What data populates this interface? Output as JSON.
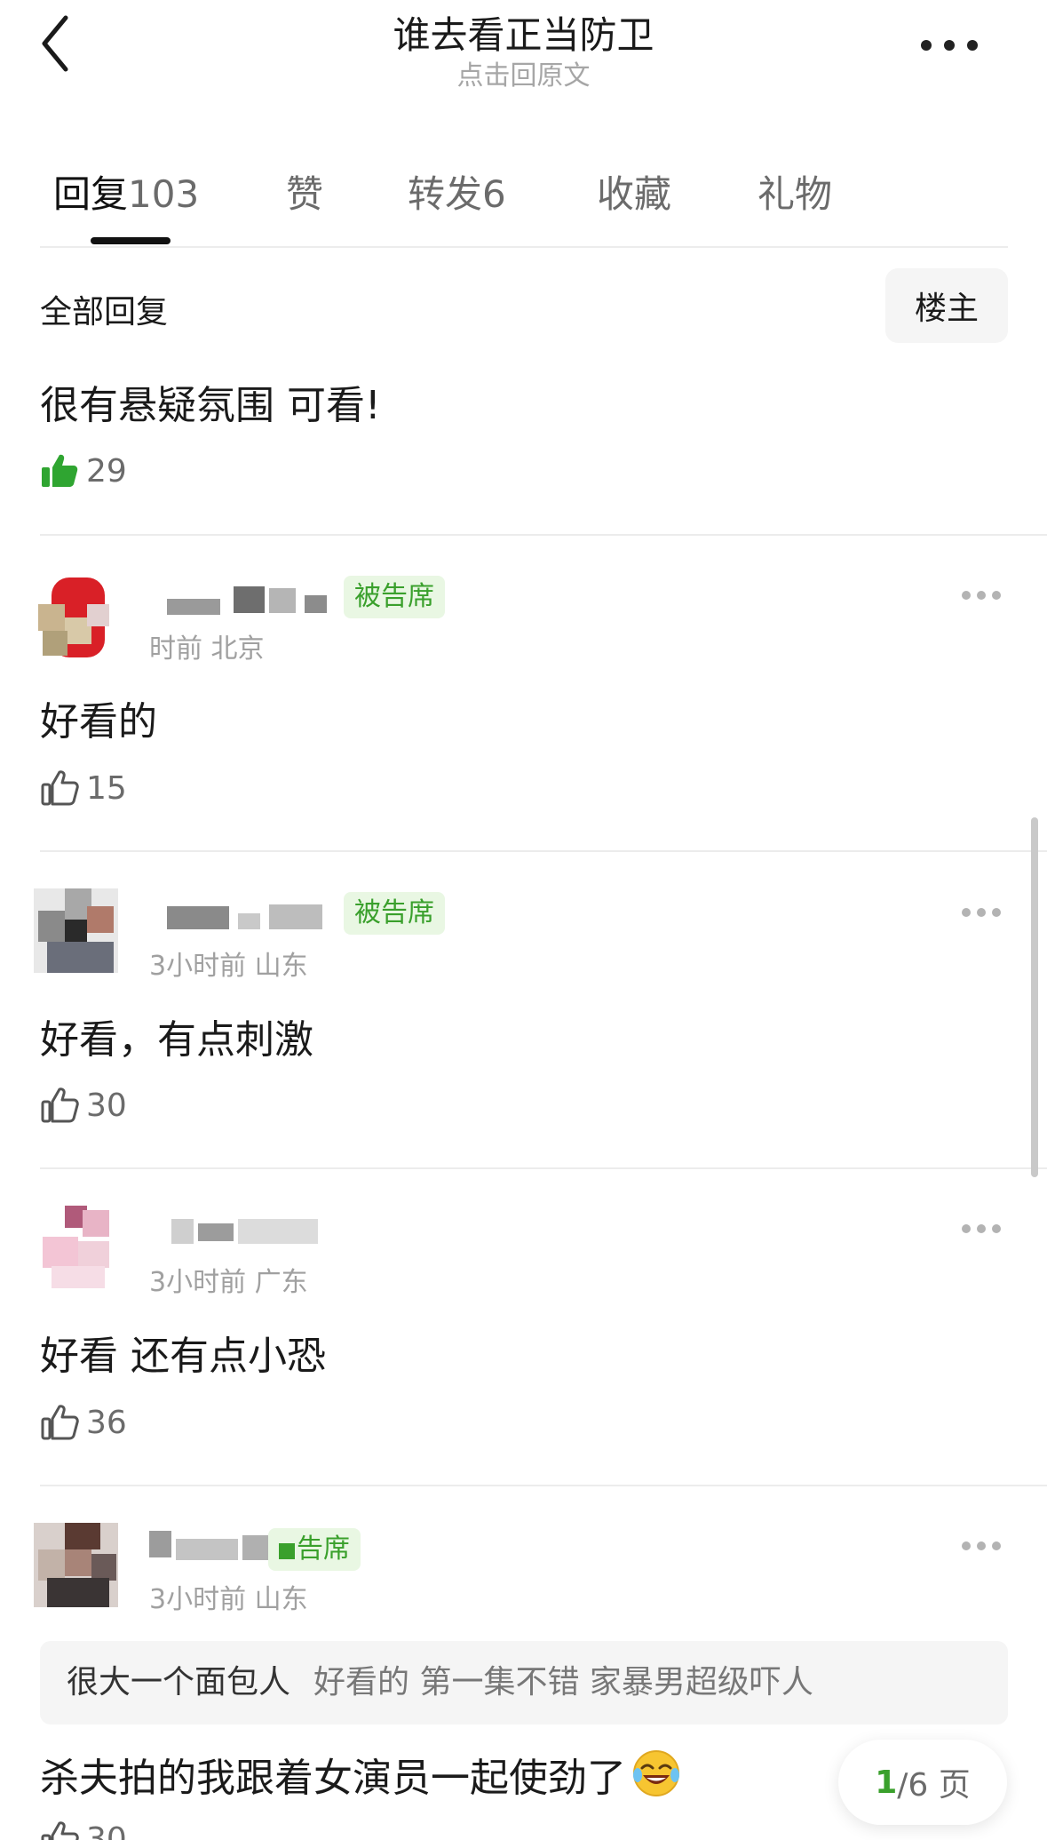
{
  "header": {
    "title": "谁去看正当防卫",
    "subtitle": "点击回原文",
    "back_icon": "chevron-left-icon",
    "more_icon": "more-horizontal-icon"
  },
  "tabs": [
    {
      "label": "回复",
      "count": "103",
      "active": true
    },
    {
      "label": "赞",
      "count": "",
      "active": false
    },
    {
      "label": "转发",
      "count": "6",
      "active": false
    },
    {
      "label": "收藏",
      "count": "",
      "active": false
    },
    {
      "label": "礼物",
      "count": "",
      "active": false
    }
  ],
  "filter": {
    "label": "全部回复",
    "host_button": "楼主"
  },
  "pinned": {
    "text": "很有悬疑氛围 可看!",
    "likes": "29",
    "liked": true
  },
  "comments": [
    {
      "badge": "被告席",
      "meta": "时前 北京",
      "text": "好看的",
      "likes": "15"
    },
    {
      "badge": "被告席",
      "meta": "3小时前 山东",
      "text": "好看，有点刺激",
      "likes": "30"
    },
    {
      "badge": "",
      "meta": "3小时前 广东",
      "text": "好看 还有点小恐",
      "likes": "36"
    },
    {
      "badge": "告席",
      "meta": "3小时前 山东",
      "quote_author": "很大一个面包人",
      "quote_text": "好看的 第一集不错 家暴男超级吓人",
      "text": "杀夫拍的我跟着女演员一起使劲了",
      "emoji": "laughing-tears-emoji",
      "likes": "30"
    }
  ],
  "pagination": {
    "current": "1",
    "total_suffix": "/6 页"
  },
  "colors": {
    "accent_green": "#3aa02c",
    "badge_bg": "#e9f7e3",
    "divider": "#ececec"
  }
}
